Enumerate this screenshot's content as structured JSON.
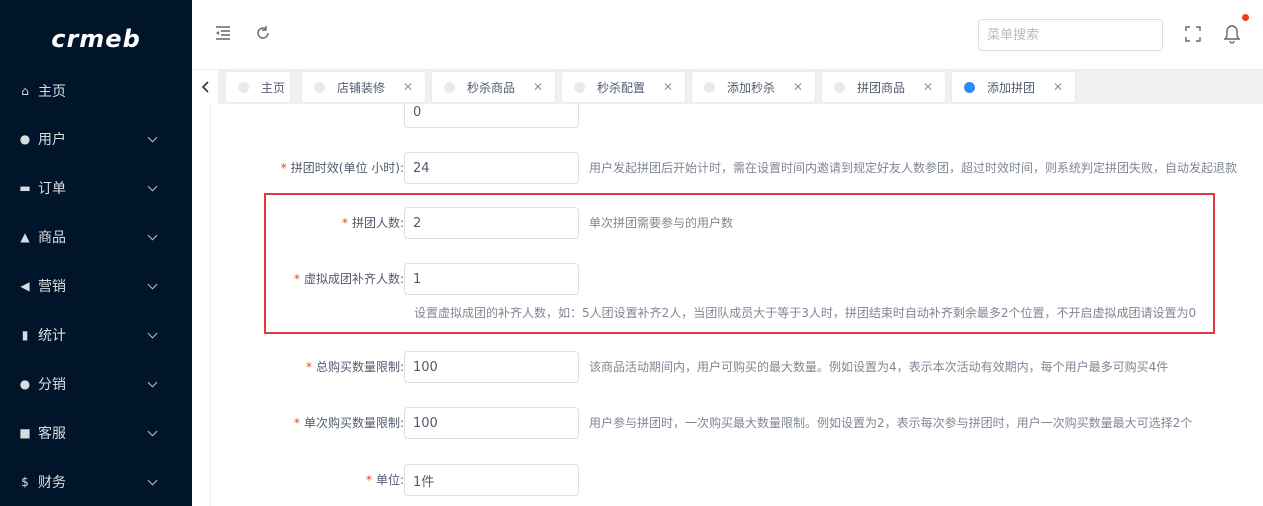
{
  "sidebar": {
    "logo": "crmeb",
    "items": [
      {
        "icon": "home-icon",
        "glyph": "⌂",
        "label": "主页",
        "has_children": false
      },
      {
        "icon": "user-icon",
        "glyph": "●",
        "label": "用户",
        "has_children": true
      },
      {
        "icon": "cart-icon",
        "glyph": "▬",
        "label": "订单",
        "has_children": true
      },
      {
        "icon": "basket-icon",
        "glyph": "▲",
        "label": "商品",
        "has_children": true
      },
      {
        "icon": "send-icon",
        "glyph": "◀",
        "label": "营销",
        "has_children": true
      },
      {
        "icon": "bar-chart-icon",
        "glyph": "▮",
        "label": "统计",
        "has_children": true
      },
      {
        "icon": "group-icon",
        "glyph": "●",
        "label": "分销",
        "has_children": true
      },
      {
        "icon": "chat-icon",
        "glyph": "■",
        "label": "客服",
        "has_children": true
      },
      {
        "icon": "dollar-icon",
        "glyph": "$",
        "label": "财务",
        "has_children": true
      }
    ]
  },
  "header": {
    "search_placeholder": "菜单搜索",
    "icons": [
      "menu-collapse-icon",
      "refresh-icon",
      "fullscreen-icon",
      "bell-icon"
    ]
  },
  "tabs": [
    {
      "label": "主页",
      "closable": false,
      "active": false
    },
    {
      "label": "店铺装修",
      "closable": true,
      "active": false
    },
    {
      "label": "秒杀商品",
      "closable": true,
      "active": false
    },
    {
      "label": "秒杀配置",
      "closable": true,
      "active": false
    },
    {
      "label": "添加秒杀",
      "closable": true,
      "active": false
    },
    {
      "label": "拼团商品",
      "closable": true,
      "active": false
    },
    {
      "label": "添加拼团",
      "closable": true,
      "active": true
    }
  ],
  "form": {
    "top_partial_value": "0",
    "rows": [
      {
        "label": "拼团时效(单位 小时):",
        "value": "24",
        "tip": "用户发起拼团后开始计时，需在设置时间内邀请到规定好友人数参团，超过时效时间，则系统判定拼团失败，自动发起退款"
      },
      {
        "label": "拼团人数:",
        "value": "2",
        "tip": "单次拼团需要参与的用户数"
      },
      {
        "label": "虚拟成团补齐人数:",
        "value": "1",
        "tip": "设置虚拟成团的补齐人数，如：5人团设置补齐2人，当团队成员大于等于3人时，拼团结束时自动补齐剩余最多2个位置，不开启虚拟成团请设置为0"
      },
      {
        "label": "总购买数量限制:",
        "value": "100",
        "tip": "该商品活动期间内，用户可购买的最大数量。例如设置为4，表示本次活动有效期内，每个用户最多可购买4件"
      },
      {
        "label": "单次购买数量限制:",
        "value": "100",
        "tip": "用户参与拼团时，一次购买最大数量限制。例如设置为2，表示每次参与拼团时，用户一次购买数量最大可选择2个"
      },
      {
        "label": "单位:",
        "value": "1件",
        "tip": ""
      }
    ]
  },
  "colors": {
    "sidebar_bg": "#001529",
    "required_star": "#ed4014",
    "active_tab_dot": "#2d8cf0",
    "highlight_border": "#e0393e"
  }
}
